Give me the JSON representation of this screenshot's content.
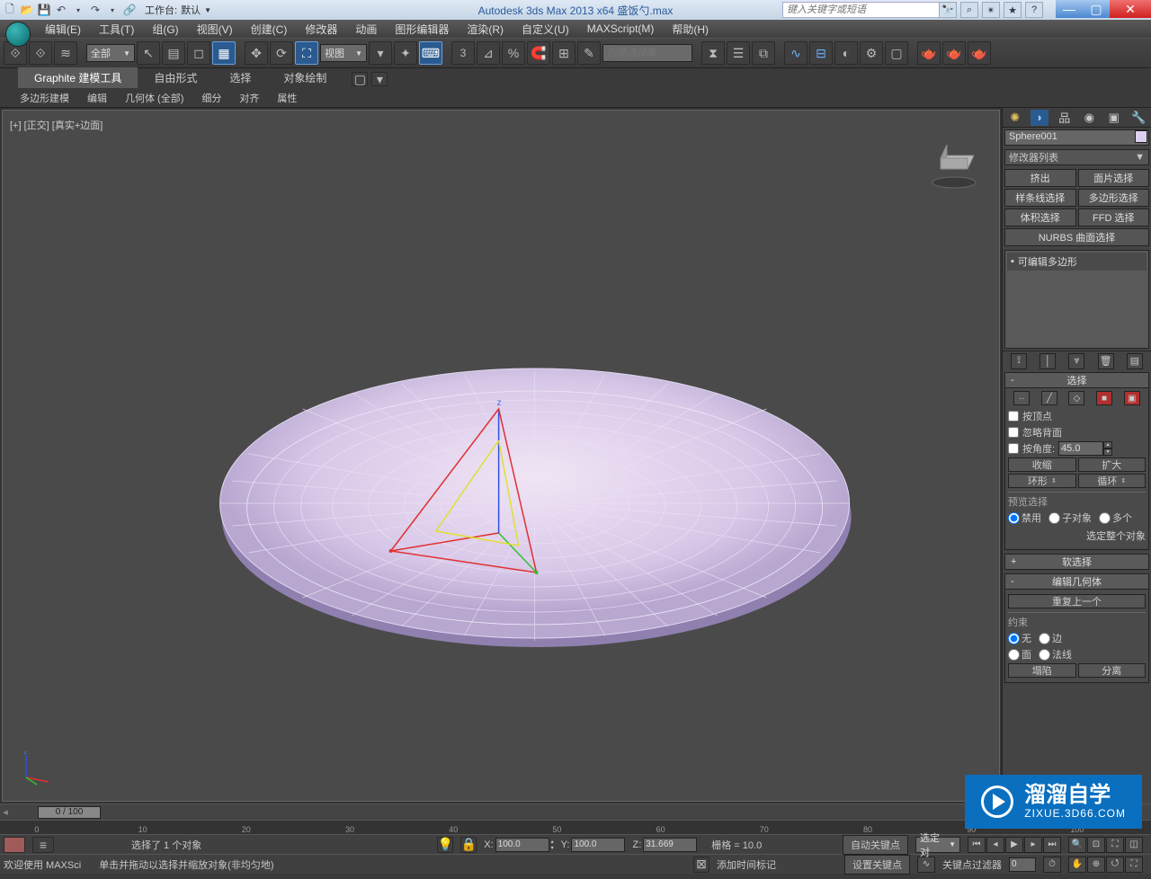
{
  "titlebar": {
    "workspace_label": "工作台:",
    "workspace_value": "默认",
    "app_title": "Autodesk 3ds Max  2013 x64     盛饭勺.max",
    "search_placeholder": "键入关键字或短语"
  },
  "menu": [
    "编辑(E)",
    "工具(T)",
    "组(G)",
    "视图(V)",
    "创建(C)",
    "修改器",
    "动画",
    "图形编辑器",
    "渲染(R)",
    "自定义(U)",
    "MAXScript(M)",
    "帮助(H)"
  ],
  "toolbar": {
    "filter_dd": "全部",
    "refcoord_dd": "视图",
    "setname_placeholder": "创建选择集"
  },
  "ribbon": {
    "tabs": [
      "Graphite 建模工具",
      "自由形式",
      "选择",
      "对象绘制"
    ],
    "panel": [
      "多边形建模",
      "编辑",
      "几何体 (全部)",
      "细分",
      "对齐",
      "属性"
    ]
  },
  "viewport": {
    "label": "[+] [正交] [真实+边面]"
  },
  "cmd": {
    "obj_name": "Sphere001",
    "modlist_label": "修改器列表",
    "sel_btns": [
      "挤出",
      "面片选择",
      "样条线选择",
      "多边形选择",
      "体积选择",
      "FFD 选择"
    ],
    "nurbs_btn": "NURBS 曲面选择",
    "stack_item": "可编辑多边形",
    "rollouts": {
      "selection": {
        "title": "选择",
        "byvert": "按顶点",
        "ignback": "忽略背面",
        "byang": "按角度:",
        "ang_val": "45.0",
        "shrink": "收缩",
        "grow": "扩大",
        "ring": "环形",
        "loop": "循环",
        "preview": "预览选择",
        "r_disable": "禁用",
        "r_subobj": "子对象",
        "r_multi": "多个",
        "whole": "选定整个对象"
      },
      "soft": "软选择",
      "editgeo": {
        "title": "编辑几何体",
        "repeat": "重复上一个",
        "constrain": "约束",
        "none": "无",
        "edge": "边",
        "face": "面",
        "normal": "法线",
        "collapse": "塌陷",
        "detach": "分离"
      }
    }
  },
  "timeline": {
    "slider_text": "0 / 100",
    "ticks": [
      0,
      10,
      20,
      30,
      40,
      50,
      60,
      70,
      80,
      90,
      100
    ]
  },
  "status": {
    "sel_text": "选择了 1 个对象",
    "prompt": "单击并拖动以选择并缩放对象(非均匀地)",
    "x": "100.0",
    "y": "100.0",
    "z": "31.669",
    "grid": "栅格 = 10.0",
    "autokey": "自动关键点",
    "setkey": "设置关键点",
    "welcome": "欢迎使用 MAXSci",
    "addtime": "添加时间标记",
    "keysel": "选定对",
    "keyfilter": "关键点过滤器"
  },
  "watermark": {
    "big": "溜溜自学",
    "small": "ZIXUE.3D66.COM"
  }
}
